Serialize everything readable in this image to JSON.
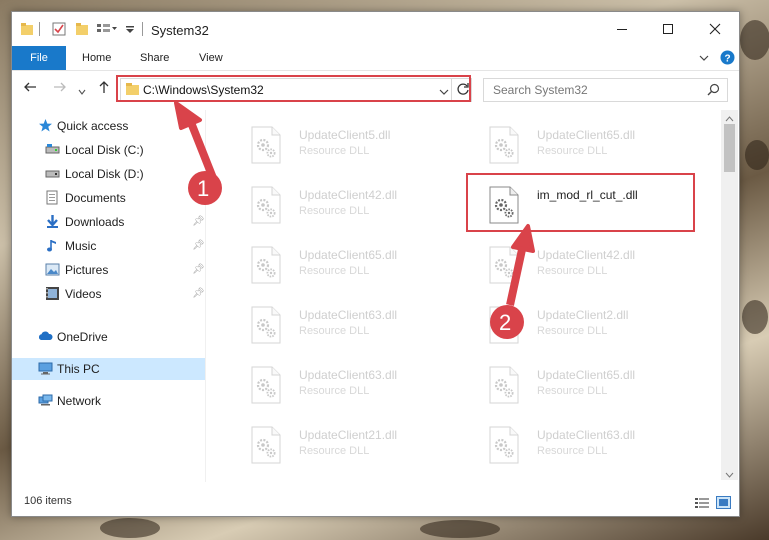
{
  "window": {
    "title": "System32",
    "title_bar_buttons": [
      "minimize",
      "maximize",
      "close"
    ]
  },
  "ribbon": {
    "tabs": [
      "File",
      "Home",
      "Share",
      "View"
    ]
  },
  "address_bar": {
    "path": "C:\\Windows\\System32",
    "search_placeholder": "Search System32"
  },
  "sidebar": {
    "items": [
      {
        "label": "Quick access",
        "icon": "star-icon"
      },
      {
        "label": "Local Disk (C:)",
        "icon": "drive-icon"
      },
      {
        "label": "Local Disk (D:)",
        "icon": "drive-icon"
      },
      {
        "label": "Documents",
        "icon": "documents-icon"
      },
      {
        "label": "Downloads",
        "icon": "download-icon"
      },
      {
        "label": "Music",
        "icon": "music-icon"
      },
      {
        "label": "Pictures",
        "icon": "pictures-icon"
      },
      {
        "label": "Videos",
        "icon": "videos-icon"
      },
      {
        "label": "OneDrive",
        "icon": "cloud-icon"
      },
      {
        "label": "This PC",
        "icon": "computer-icon",
        "selected": true
      },
      {
        "label": "Network",
        "icon": "network-icon"
      }
    ]
  },
  "files": {
    "left_column": [
      {
        "name": "UpdateClient5.dll",
        "type": "Resource DLL"
      },
      {
        "name": "UpdateClient42.dll",
        "type": "Resource DLL"
      },
      {
        "name": "UpdateClient65.dll",
        "type": "Resource DLL"
      },
      {
        "name": "UpdateClient63.dll",
        "type": "Resource DLL"
      },
      {
        "name": "UpdateClient63.dll",
        "type": "Resource DLL"
      },
      {
        "name": "UpdateClient21.dll",
        "type": "Resource DLL"
      }
    ],
    "right_column": [
      {
        "name": "UpdateClient65.dll",
        "type": "Resource DLL"
      },
      {
        "name": "im_mod_rl_cut_.dll",
        "type": ""
      },
      {
        "name": "UpdateClient42.dll",
        "type": "Resource DLL"
      },
      {
        "name": "UpdateClient2.dll",
        "type": "Resource DLL"
      },
      {
        "name": "UpdateClient65.dll",
        "type": "Resource DLL"
      },
      {
        "name": "UpdateClient63.dll",
        "type": "Resource DLL"
      }
    ]
  },
  "status": {
    "item_count": "106 items"
  },
  "annotations": {
    "step1": "1",
    "step2": "2",
    "highlight_color": "#d9434a"
  }
}
